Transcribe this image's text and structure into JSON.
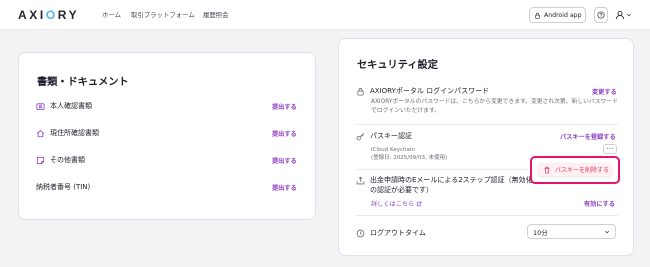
{
  "header": {
    "logo_text_1": "AXI",
    "logo_text_2": "O",
    "logo_text_3": "RY",
    "nav": [
      "ホーム",
      "取引プラットフォーム",
      "履歴照会"
    ],
    "android_label": "Android app"
  },
  "documents": {
    "title": "書類・ドキュメント",
    "items": [
      {
        "label": "本人確認書類",
        "action": "提出する"
      },
      {
        "label": "現住所確認書類",
        "action": "提出する"
      },
      {
        "label": "その他書類",
        "action": "提出する"
      },
      {
        "label": "納税者番号 (TIN)",
        "action": "提出する"
      }
    ]
  },
  "security": {
    "title": "セキュリティ設定",
    "password": {
      "label": "AXIORYポータル ログインパスワード",
      "action": "変更する",
      "description": "AXIORYポータルのパスワードは、こちらから変更できます。変更され次第、新しいパスワードでログインいただけます。"
    },
    "passkey": {
      "label": "パスキー認証",
      "action": "パスキーを登録する",
      "device": "iCloud Keychain",
      "registered": "(登録日: 2025/09/03, 未使用)",
      "menu_dots": "...",
      "delete_label": "パスキーを削除する"
    },
    "two_step": {
      "label_line1": "出金申請時のEメールによる2ステップ認証（無効化",
      "label_line2": "の認証が必要です）",
      "details_link": "詳しくはこちら",
      "action": "有効にする"
    },
    "logout": {
      "label": "ログアウトタイム",
      "selected": "10分"
    }
  },
  "colors": {
    "accent": "#8b3fc2",
    "logo_blue": "#4fb6ee",
    "highlight": "#e3136f",
    "danger": "#e23b5a"
  }
}
